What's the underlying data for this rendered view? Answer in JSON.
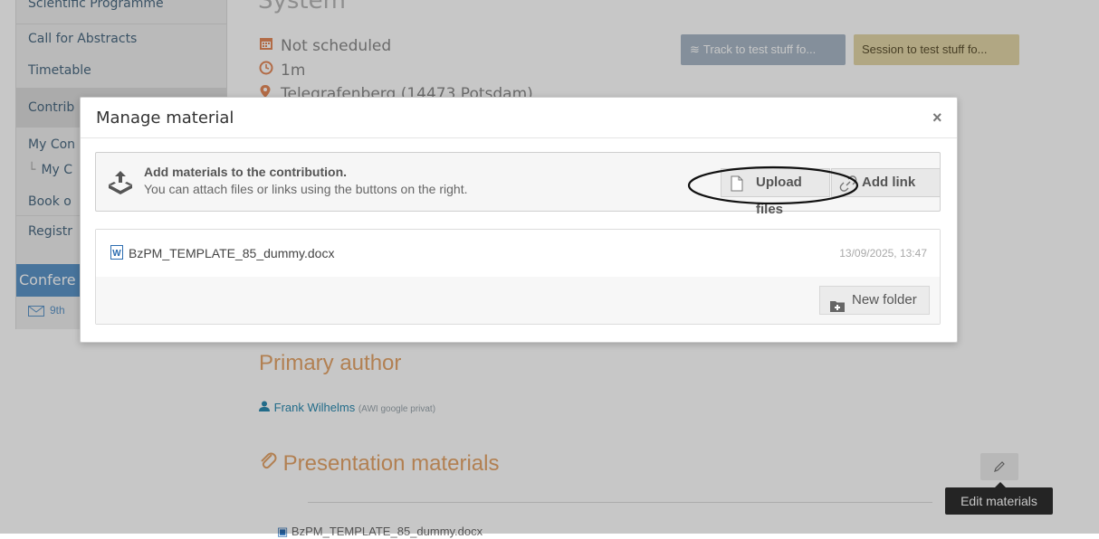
{
  "sidebar": {
    "items": [
      {
        "label": "Scientific Programme",
        "active": false
      },
      {
        "label": "Call for Abstracts",
        "active": false
      },
      {
        "label": "Timetable",
        "active": false
      },
      {
        "label": "Contrib",
        "active": true
      },
      {
        "label": "My Con",
        "active": false
      },
      {
        "label": "My C",
        "active": false
      },
      {
        "label": "Book o",
        "active": false
      },
      {
        "label": "Registr",
        "active": false
      }
    ],
    "section_header": "Confere",
    "mail_text": "9th"
  },
  "contribution": {
    "title_fragment": "System",
    "schedule": "Not scheduled",
    "duration": "1m",
    "location": "Telegrafenberg (14473 Potsdam)",
    "track_label": "Track to test stuff fo...",
    "session_label": "Session to test stuff fo...",
    "primary_author_heading": "Primary author",
    "author_name": "Frank Wilhelms",
    "author_affiliation": "(AWI google privat)",
    "materials_heading": "Presentation materials",
    "materials_file": "BzPM_TEMPLATE_85_dummy.docx",
    "edit_tooltip": "Edit materials"
  },
  "modal": {
    "title": "Manage material",
    "close_label": "×",
    "upload_heading": "Add materials to the contribution.",
    "upload_subtext": "You can attach files or links using the buttons on the right.",
    "upload_files_label": "Upload files",
    "add_link_label": "Add link",
    "files": [
      {
        "name": "BzPM_TEMPLATE_85_dummy.docx",
        "date": "13/09/2025, 13:47"
      }
    ],
    "new_folder_label": "New folder"
  },
  "colors": {
    "accent_orange": "#e4a56a",
    "sidebar_blue": "#5d95c8",
    "link_blue": "#2b8ab0",
    "annotation": "#111111"
  },
  "icons": [
    "calendar-icon",
    "clock-icon",
    "map-pin-icon",
    "layers-icon",
    "user-icon",
    "paperclip-icon",
    "pencil-icon",
    "upload-icon",
    "file-icon",
    "link-icon",
    "word-doc-icon",
    "folder-plus-icon",
    "mail-icon",
    "close-icon"
  ]
}
